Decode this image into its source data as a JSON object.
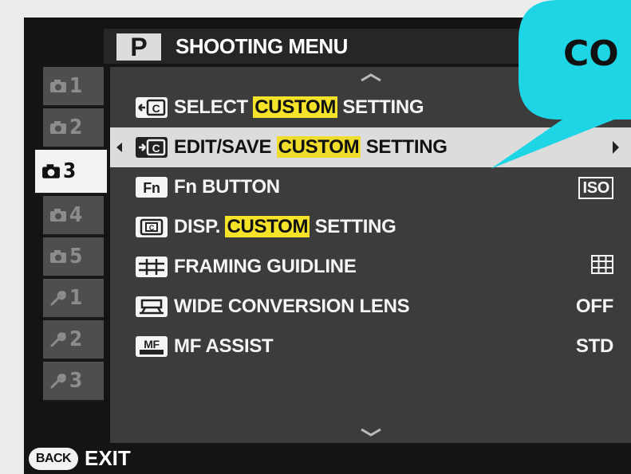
{
  "header": {
    "mode_badge": "P",
    "title": "SHOOTING MENU"
  },
  "sidebar": {
    "tabs": [
      {
        "icon": "camera-icon",
        "num": "1",
        "active": false
      },
      {
        "icon": "camera-icon",
        "num": "2",
        "active": false
      },
      {
        "icon": "camera-icon",
        "num": "3",
        "active": true
      },
      {
        "icon": "camera-icon",
        "num": "4",
        "active": false
      },
      {
        "icon": "camera-icon",
        "num": "5",
        "active": false
      },
      {
        "icon": "wrench-icon",
        "num": "1",
        "active": false
      },
      {
        "icon": "wrench-icon",
        "num": "2",
        "active": false
      },
      {
        "icon": "wrench-icon",
        "num": "3",
        "active": false
      }
    ]
  },
  "menu": {
    "items": [
      {
        "icon": "select-custom-setting-icon",
        "before": "SELECT ",
        "highlight": "CUSTOM",
        "after": " SETTING",
        "value": ""
      },
      {
        "icon": "edit-save-custom-setting-icon",
        "before": "EDIT/SAVE ",
        "highlight": "CUSTOM",
        "after": " SETTING",
        "value": "",
        "selected": true
      },
      {
        "icon": "fn-icon",
        "before": "Fn BUTTON",
        "highlight": "",
        "after": "",
        "value": "ISO"
      },
      {
        "icon": "disp-custom-icon",
        "before": "DISP. ",
        "highlight": "CUSTOM",
        "after": " SETTING",
        "value": ""
      },
      {
        "icon": "framing-grid-icon",
        "before": "FRAMING GUIDLINE",
        "highlight": "",
        "after": "",
        "value": "grid-icon"
      },
      {
        "icon": "wide-conversion-lens-icon",
        "before": "WIDE CONVERSION LENS",
        "highlight": "",
        "after": "",
        "value": "OFF"
      },
      {
        "icon": "mf-assist-icon",
        "before": "MF ASSIST",
        "highlight": "",
        "after": "",
        "value": "STD"
      }
    ]
  },
  "footer": {
    "back_button": "BACK",
    "exit_label": "EXIT"
  },
  "callout": {
    "text": "CO",
    "color": "#1ed5e6"
  },
  "colors": {
    "highlight": "#f5e32a",
    "selected_row": "#dcdcdc",
    "panel": "#3c3c3c"
  }
}
